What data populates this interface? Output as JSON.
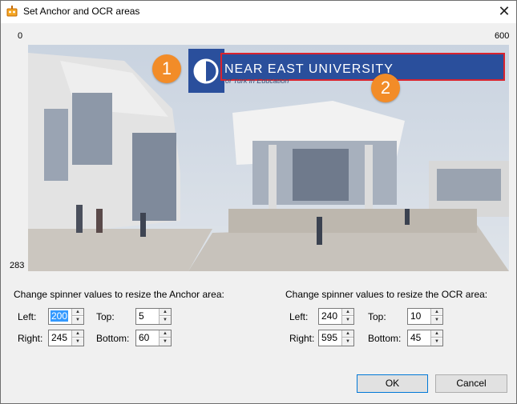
{
  "window": {
    "title": "Set Anchor and OCR areas",
    "close_glyph": "✕"
  },
  "scale": {
    "x_min": "0",
    "x_max": "600",
    "y_max": "283"
  },
  "image": {
    "banner_text": "NEAR EAST UNIVERSITY",
    "sub_text": "of Turk in Education",
    "marker_1": "1",
    "marker_2": "2"
  },
  "anchor": {
    "heading": "Change spinner values to resize the Anchor area:",
    "left_label": "Left:",
    "left_value": "200",
    "top_label": "Top:",
    "top_value": "5",
    "right_label": "Right:",
    "right_value": "245",
    "bottom_label": "Bottom:",
    "bottom_value": "60"
  },
  "ocr": {
    "heading": "Change spinner values to resize the OCR area:",
    "left_label": "Left:",
    "left_value": "240",
    "top_label": "Top:",
    "top_value": "10",
    "right_label": "Right:",
    "right_value": "595",
    "bottom_label": "Bottom:",
    "bottom_value": "45"
  },
  "buttons": {
    "ok": "OK",
    "cancel": "Cancel"
  },
  "colors": {
    "anchor_fill": "#2a4f9c",
    "ocr_border": "#d9232e",
    "marker": "#f28c28"
  }
}
